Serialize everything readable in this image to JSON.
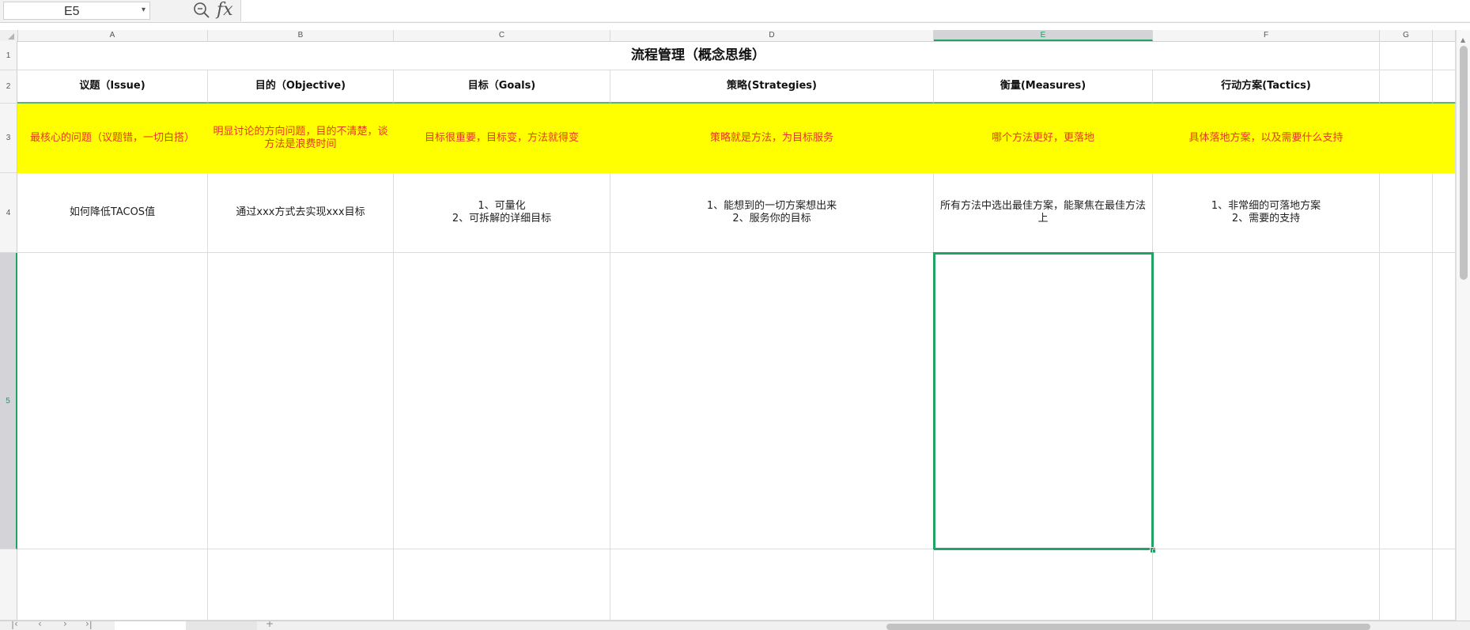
{
  "formula_bar": {
    "name_box": "E5",
    "fx_label": "fx",
    "formula_value": ""
  },
  "columns": [
    "A",
    "B",
    "C",
    "D",
    "E",
    "F",
    "G"
  ],
  "rows": [
    "1",
    "2",
    "3",
    "4",
    "5"
  ],
  "sheet": {
    "title": "流程管理（概念思维）",
    "headers": [
      "议题（Issue)",
      "目的（Objective)",
      "目标（Goals)",
      "策略(Strategies)",
      "衡量(Measures)",
      "行动方案(Tactics)"
    ],
    "descriptions": [
      "最核心的问题（议题错，一切白搭）",
      "明显讨论的方向问题，目的不清楚，谈方法是浪费时间",
      "目标很重要，目标变，方法就得变",
      "策略就是方法，为目标服务",
      "哪个方法更好，更落地",
      "具体落地方案，以及需要什么支持"
    ],
    "examples": [
      "如何降低TACOS值",
      "通过xxx方式去实现xxx目标",
      "1、可量化\n2、可拆解的详细目标",
      "1、能想到的一切方案想出来\n2、服务你的目标",
      "所有方法中选出最佳方案，能聚焦在最佳方法上",
      "1、非常细的可落地方案\n2、需要的支持"
    ]
  },
  "selected_cell": "E5",
  "colors": {
    "accent": "#21a366",
    "highlight_fill": "#ffff00",
    "highlight_text": "#e63a1e"
  },
  "icons": {
    "zoom": "zoom-search-icon",
    "formula": "fx-icon"
  }
}
